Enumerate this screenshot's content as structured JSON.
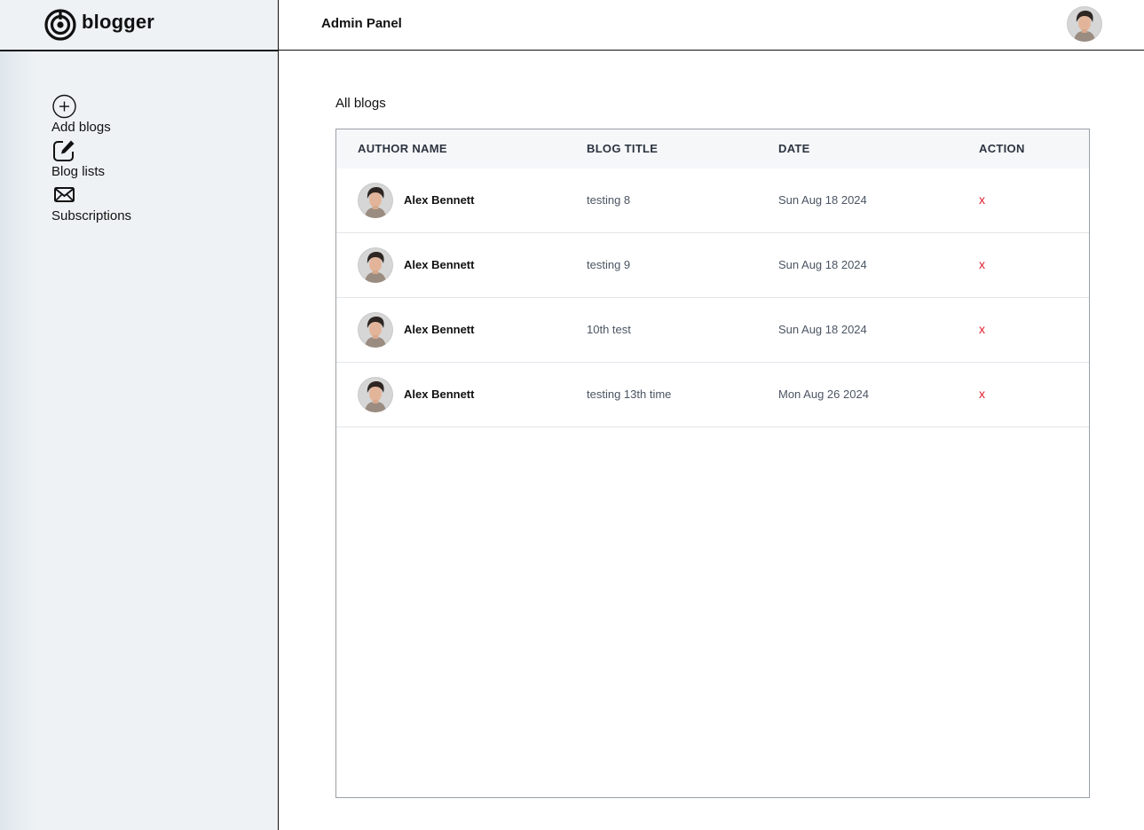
{
  "brand": {
    "name": "blogger"
  },
  "header": {
    "title": "Admin Panel"
  },
  "sidebar": {
    "items": [
      {
        "label": "Add blogs",
        "icon": "plus-circle-icon"
      },
      {
        "label": "Blog lists",
        "icon": "edit-icon"
      },
      {
        "label": "Subscriptions",
        "icon": "mail-icon"
      }
    ]
  },
  "main": {
    "section_title": "All blogs",
    "table": {
      "columns": [
        "AUTHOR NAME",
        "BLOG TITLE",
        "DATE",
        "ACTION"
      ],
      "rows": [
        {
          "author": "Alex Bennett",
          "title": "testing 8",
          "date": "Sun Aug 18 2024",
          "action": "x"
        },
        {
          "author": "Alex Bennett",
          "title": "testing 9",
          "date": "Sun Aug 18 2024",
          "action": "x"
        },
        {
          "author": "Alex Bennett",
          "title": "10th test",
          "date": "Sun Aug 18 2024",
          "action": "x"
        },
        {
          "author": "Alex Bennett",
          "title": "testing 13th time",
          "date": "Mon Aug 26 2024",
          "action": "x"
        }
      ]
    }
  },
  "colors": {
    "accent_delete": "#e11d2a",
    "sidebar_bg": "#eef2f5"
  }
}
